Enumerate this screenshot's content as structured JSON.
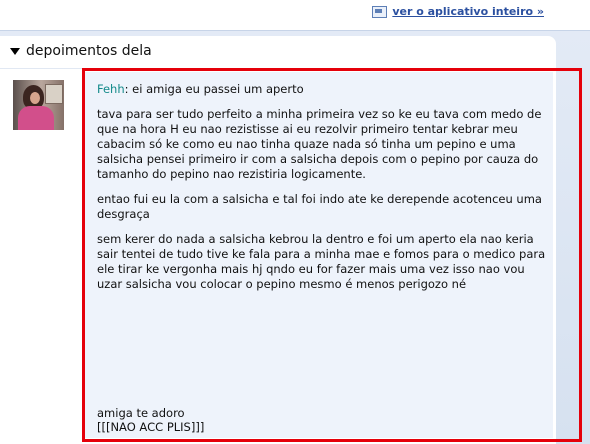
{
  "top_bar": {
    "app_link": "ver o aplicativo inteiro »"
  },
  "section": {
    "title": "depoimentos dela"
  },
  "testimonial": {
    "author": "Fehh",
    "author_suffix": ": ei amiga eu passei um aperto",
    "paragraphs": [
      "tava para ser tudo perfeito a minha primeira vez so ke eu tava com medo de que na hora H eu nao rezistisse ai eu rezolvir primeiro tentar kebrar meu cabacim só ke como eu nao tinha quaze nada só tinha um pepino e uma salsicha pensei primeiro ir com a salsicha depois com o pepino por cauza do tamanho do pepino nao rezistiria logicamente.",
      "entao fui eu la com a salsicha e tal foi indo ate ke derepende acotenceu uma desgraça",
      "sem kerer do nada a salsicha kebrou la dentro e foi um aperto ela nao keria sair tentei de tudo tive ke fala para a minha mae e fomos para o medico para ele tirar ke vergonha mais hj qndo eu for fazer mais uma vez isso nao vou uzar salsicha vou colocar o pepino mesmo é menos perigozo né"
    ],
    "closing_line_1": "amiga te adoro",
    "closing_line_2": "[[[NAO ACC PLIS]]]"
  }
}
